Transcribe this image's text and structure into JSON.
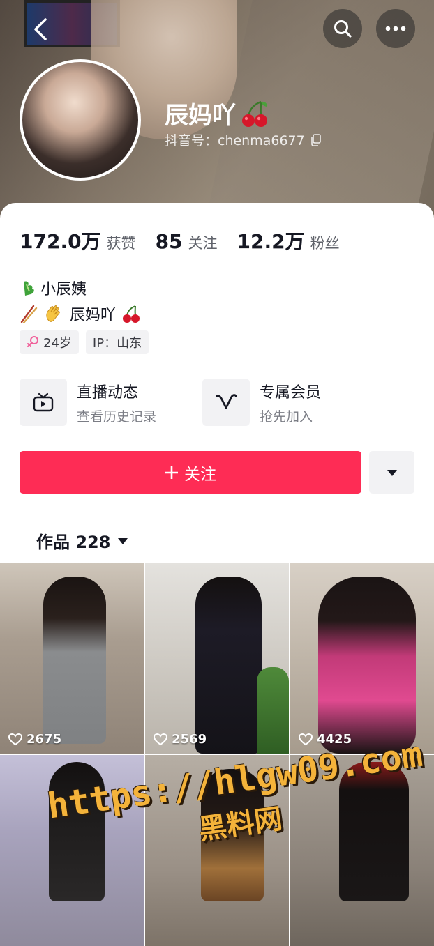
{
  "header": {
    "back_icon": "chevron-left-icon",
    "search_icon": "search-icon",
    "more_icon": "ellipsis-icon"
  },
  "profile": {
    "nickname": "辰妈吖",
    "douyin_id_label": "抖音号：chenma6677",
    "copy_icon": "copy-icon"
  },
  "stats": [
    {
      "num": "172.0万",
      "label": "获赞"
    },
    {
      "num": "85",
      "label": "关注"
    },
    {
      "num": "12.2万",
      "label": "粉丝"
    }
  ],
  "bio": {
    "line1": "小辰姨",
    "line2": "辰妈吖"
  },
  "tags": [
    {
      "icon": "female-icon",
      "label": "24岁"
    },
    {
      "icon": "",
      "label": "IP：山东"
    }
  ],
  "features": [
    {
      "icon": "tv-icon",
      "title": "直播动态",
      "subtitle": "查看历史记录"
    },
    {
      "icon": "vip-v-icon",
      "title": "专属会员",
      "subtitle": "抢先加入"
    }
  ],
  "actions": {
    "follow_label": "关注",
    "more_icon": "caret-down-icon"
  },
  "works": {
    "tab_label": "作品 228"
  },
  "videos": [
    {
      "likes": "2675"
    },
    {
      "likes": "2569"
    },
    {
      "likes": "4425"
    },
    {
      "likes": ""
    },
    {
      "likes": ""
    },
    {
      "likes": ""
    }
  ],
  "watermark": {
    "line1": "https://hlgw09.com",
    "line2": "黑料网"
  },
  "colors": {
    "accent": "#fe2c55",
    "tag_bg": "#f2f2f4",
    "watermark": "#f4b33a"
  }
}
